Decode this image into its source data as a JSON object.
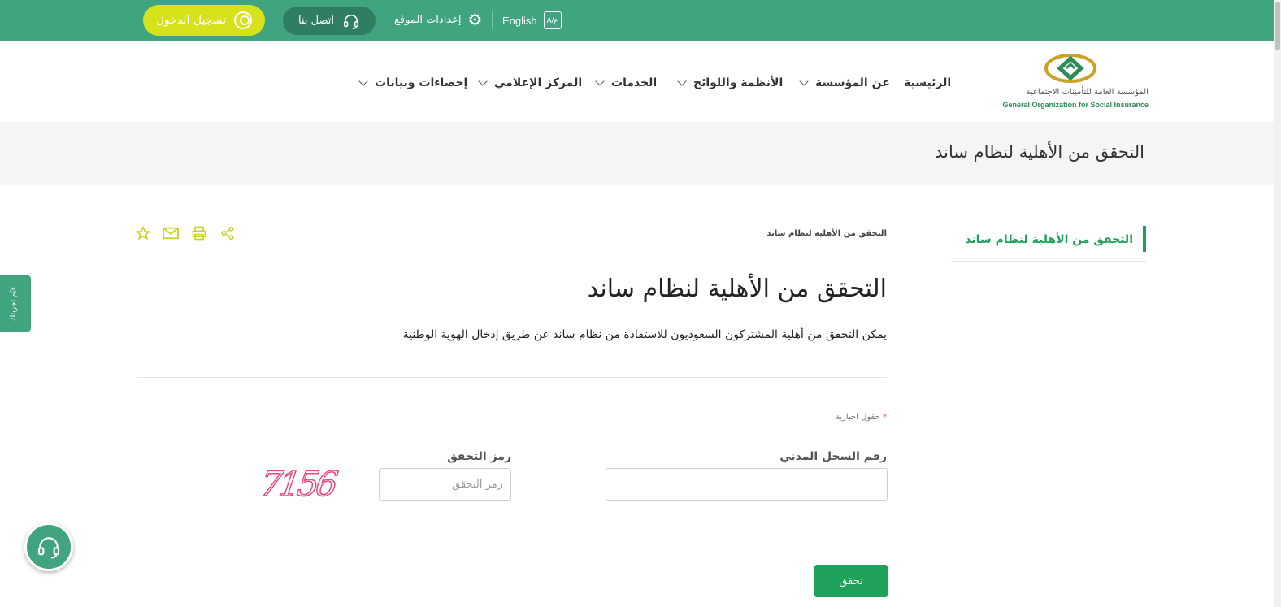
{
  "topbar": {
    "login_label": "تسجيل الدخول",
    "contact_label": "اتصل بنا",
    "settings_label": "إعدادات الموقع",
    "language_label": "English"
  },
  "header": {
    "logo_ar": "المؤسسة العامة للتأمينات الاجتماعية",
    "logo_en": "General Organization for Social Insurance",
    "nav": [
      {
        "label": "الرئيسية"
      },
      {
        "label": "عن المؤسسة"
      },
      {
        "label": "الأنظمة واللوائح"
      },
      {
        "label": "الخدمات"
      },
      {
        "label": "المركز الإعلامي"
      },
      {
        "label": "إحصاءات وبيانات"
      }
    ]
  },
  "page": {
    "title": "التحقق من الأهلية لنظام ساند",
    "breadcrumb": "التحقق من الأهلية لنظام ساند",
    "heading": "التحقق من الأهلية لنظام ساند",
    "description": "يمكن التحقق من أهلية المشتركون السعوديون للاستفادة من نظام ساند عن طريق إدخال الهوية الوطنية",
    "required_note": "حقول اجبارية",
    "required_mark": "*"
  },
  "sidebar": {
    "items": [
      {
        "label": "التحقق من الأهلية لنظام ساند"
      }
    ]
  },
  "form": {
    "civil_id_label": "رقم السجل المدني",
    "civil_id_value": "",
    "captcha_label": "رمز التحقق",
    "captcha_placeholder": "رمز التحقق",
    "captcha_value": "",
    "captcha_text": "7156",
    "submit_label": "تحقق"
  },
  "floating": {
    "feedback_label": "قيّم تجربتك"
  },
  "toolbar_icons": [
    "star-icon",
    "mail-icon",
    "print-icon",
    "share-icon"
  ],
  "colors": {
    "brand_green": "#40a57f",
    "accent_green": "#1fa15b",
    "accent_yellow": "#d6e21a",
    "captcha_pink": "#e8467c"
  }
}
